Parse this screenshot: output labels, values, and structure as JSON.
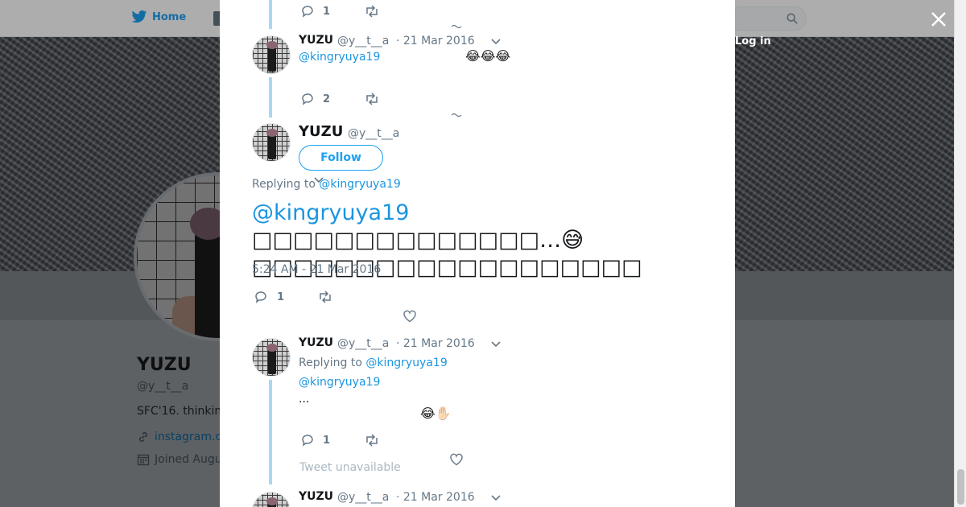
{
  "background": {
    "nav_home": "Home",
    "login_partial": "Log in",
    "profile_name": "YUZU",
    "profile_handle": "@y__t__a",
    "profile_bio": "SFC'16. thinkin",
    "profile_link": "instagram.c",
    "profile_joined": "Joined Augu"
  },
  "modal": {
    "tweet_top_partial": {
      "reply_count": "1"
    },
    "tweet_1": {
      "name": "YUZU",
      "handle": "@y__t__a",
      "date": "· 21 Mar 2016",
      "mention": "@kingryuya19",
      "emoji": "😂😂😂",
      "reply_count": "2"
    },
    "main_tweet": {
      "name": "YUZU",
      "handle": "@y__t__a",
      "follow_label": "Follow",
      "replying_to_label": "Replying to",
      "replying_to_handle": "@kingryuya19",
      "text_mention": "@kingryuya19",
      "text_line1": "□□□□□□□□□□□□□□…",
      "text_emoji": "😅",
      "text_line2": "□□□□□□□□□□□□□□□□□□□",
      "timestamp": "5:24 AM - 21 Mar 2016",
      "reply_count": "1"
    },
    "tweet_3": {
      "name": "YUZU",
      "handle": "@y__t__a",
      "date": "· 21 Mar 2016",
      "replying_to_label": "Replying to",
      "replying_to_handle": "@kingryuya19",
      "mention": "@kingryuya19",
      "text": "...",
      "emoji": "😂✋🏻",
      "reply_count": "1",
      "unavailable": "Tweet unavailable"
    },
    "tweet_4": {
      "name": "YUZU",
      "handle": "@y__t__a",
      "date": "· 21 Mar 2016"
    }
  },
  "colors": {
    "accent": "#1da1f2",
    "mention": "#1b95e0",
    "muted": "#657786",
    "thread_line": "#a8d8f3"
  }
}
